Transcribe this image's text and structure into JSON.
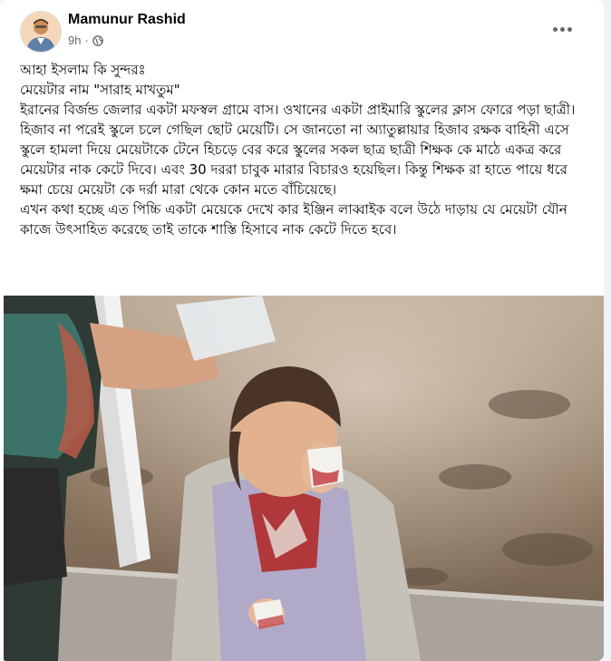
{
  "post": {
    "author": "Mamunur Rashid",
    "time": "9h",
    "separator": "·",
    "privacy_icon": "globe-icon",
    "more_icon": "more-options-icon",
    "text": [
      "আহা ইসলাম কি সুন্দরঃ",
      "মেয়েটার নাম \"সারাহ মাখতুম\"",
      "ইরানের বির্জন্ড জেলার একটা মফস্বল গ্রামে বাস। ওখানের একটা প্রাইমারি স্কুলের ক্লাস ফোরে পড়া ছাত্রী।",
      "হিজাব না পরেই স্কুলে চলে গেছিল ছোট মেয়েটি। সে জানতো না অ্যাতুল্লায়ার হিজাব রক্ষক বাহিনী এসে স্কুলে হামলা দিয়ে মেয়েটাকে টেনে হিচড়ে বের করে স্কুলের সকল ছাত্র ছাত্রী শিক্ষক কে মাঠে একত্র করে মেয়েটার নাক কেটে দিবে। এবং 30 দররা চাবুক মারার বিচারও হয়েছিল। কিন্তু শিক্ষক রা হাতে পায়ে ধরে ক্ষমা চেয়ে মেয়েটা কে দর্রা মারা থেকে কোন মতে বাঁচিয়েছে।",
      "এখন কথা হচ্ছে এত পিচ্চি একটা মেয়েকে দেখে কার ইঞ্জিন লাব্বাইক বলে উঠে দাড়ায় যে মেয়েটা যৌন কাজে উৎসাহিত করেছে তাই তাকে শাস্তি হিসাবে নাক কেটে দিতে হবে।"
    ]
  },
  "colors": {
    "background": "#f0f2f5",
    "card": "#ffffff",
    "text": "#050505",
    "secondary_text": "#65676b"
  }
}
